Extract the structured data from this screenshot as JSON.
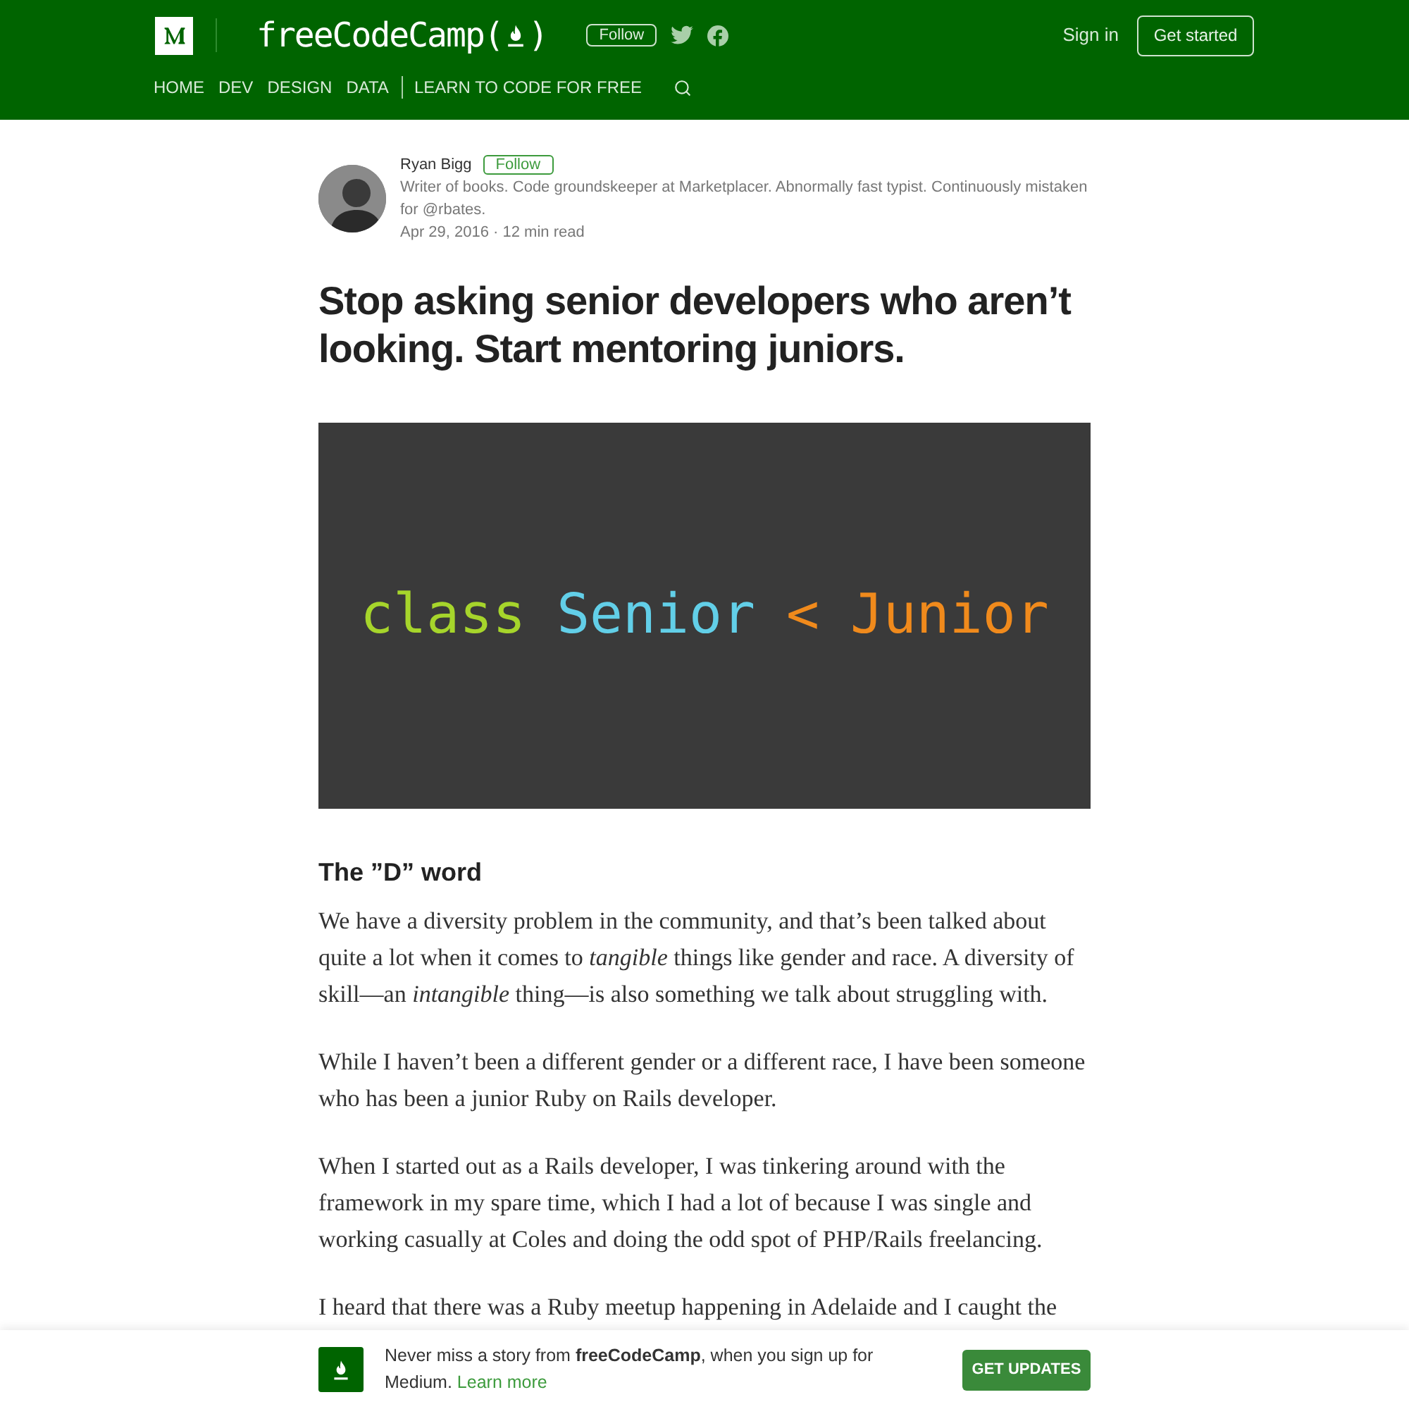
{
  "header": {
    "logo": {
      "before": "freeCodeCamp(",
      "after": ")"
    },
    "follow": "Follow",
    "sign_in": "Sign in",
    "get_started": "Get started",
    "nav": [
      "HOME",
      "DEV",
      "DESIGN",
      "DATA",
      "LEARN TO CODE FOR FREE"
    ]
  },
  "author": {
    "name": "Ryan Bigg",
    "follow": "Follow",
    "bio": "Writer of books. Code groundskeeper at Marketplacer. Abnormally fast typist. Continuously mistaken for @rbates.",
    "meta": "Apr 29, 2016 · 12 min read"
  },
  "title": "Stop asking senior developers who aren’t looking. Start mentoring juniors.",
  "code_image": {
    "tokens": [
      {
        "text": "class",
        "color": "#a6d52b"
      },
      {
        "text": "Senior",
        "color": "#62cfe8"
      },
      {
        "text": "<",
        "color": "#f08a1c"
      },
      {
        "text": "Junior",
        "color": "#f08a1c"
      }
    ]
  },
  "heading": "The ”D” word",
  "paragraphs": [
    "We have a diversity problem in the community, and that’s been talked about quite a lot when it comes to *tangible* things like gender and race. A diversity of skill—an *intangible* thing—is also something we talk about struggling with.",
    "While I haven’t been a different gender or a different race, I have been someone who has been a junior Ruby on Rails developer.",
    "When I started out as a Rails developer, I was tinkering around with the framework in my spare time, which I had a lot of because I was single and working casually at Coles and doing the odd spot of PHP/Rails freelancing.",
    "I heard that there was a Ruby meetup happening in Adelaide and I caught the"
  ],
  "banner": {
    "text": "Never miss a story from **freeCodeCamp**, when you sign up for Medium.",
    "link": "Learn more",
    "button": "GET UPDATES"
  }
}
